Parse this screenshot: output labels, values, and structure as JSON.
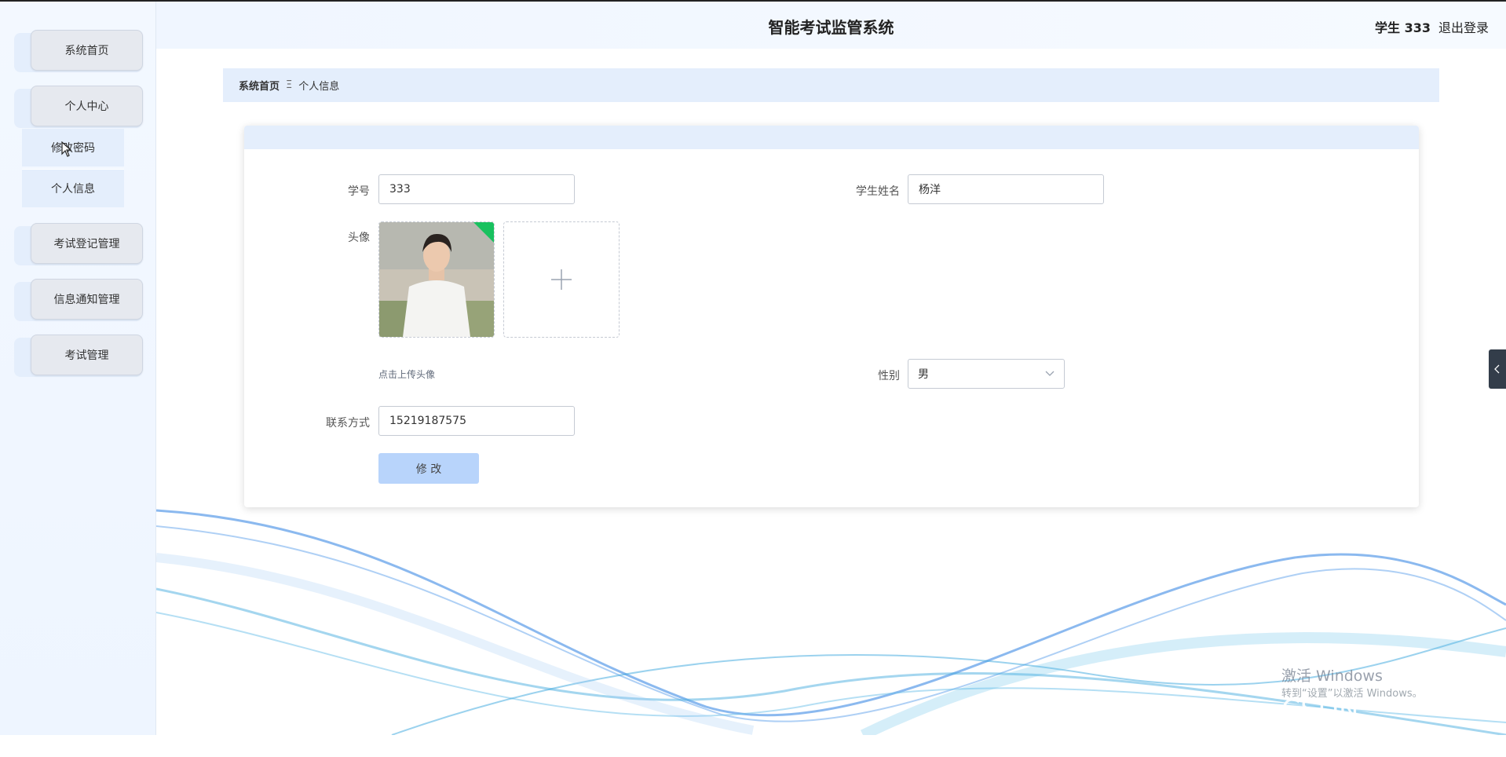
{
  "header": {
    "title": "智能考试监管系统",
    "user": "学生 333",
    "logout": "退出登录"
  },
  "sidebar": {
    "items": [
      {
        "label": "系统首页"
      },
      {
        "label": "个人中心",
        "children": [
          {
            "label": "修改密码"
          },
          {
            "label": "个人信息"
          }
        ]
      },
      {
        "label": "考试登记管理"
      },
      {
        "label": "信息通知管理"
      },
      {
        "label": "考试管理"
      }
    ]
  },
  "breadcrumb": {
    "home": "系统首页",
    "separator": "Ξ",
    "current": "个人信息"
  },
  "form": {
    "student_id": {
      "label": "学号",
      "value": "333"
    },
    "student_name": {
      "label": "学生姓名",
      "value": "杨洋"
    },
    "avatar": {
      "label": "头像",
      "hint": "点击上传头像"
    },
    "gender": {
      "label": "性别",
      "value": "男"
    },
    "contact": {
      "label": "联系方式",
      "value": "15219187575"
    },
    "submit_label": "修 改"
  },
  "watermark": {
    "line1": "激活 Windows",
    "line2": "转到“设置”以激活 Windows。",
    "line3": "CSDN @sheji712"
  },
  "colors": {
    "accent": "#b8d4fb",
    "menu_bg": "#e4eefc"
  }
}
